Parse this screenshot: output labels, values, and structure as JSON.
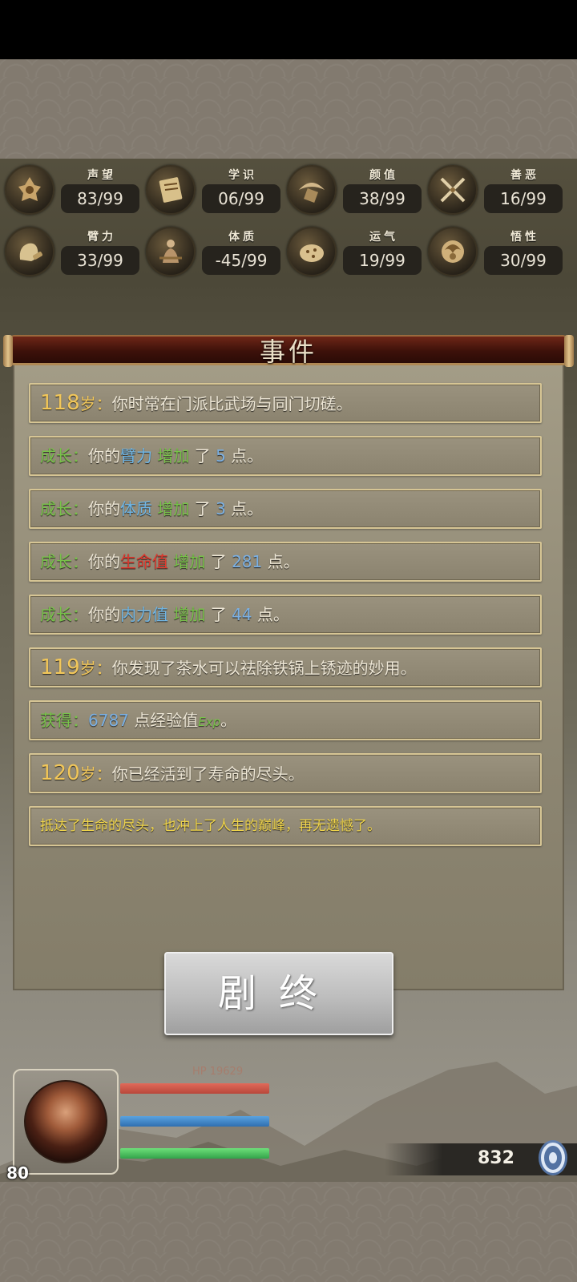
{
  "attributes": [
    {
      "label": "声望",
      "value": "83/99",
      "icon": "fame-icon"
    },
    {
      "label": "学识",
      "value": "06/99",
      "icon": "knowledge-icon"
    },
    {
      "label": "颜值",
      "value": "38/99",
      "icon": "appearance-icon"
    },
    {
      "label": "善恶",
      "value": "16/99",
      "icon": "morality-icon"
    },
    {
      "label": "臂力",
      "value": "33/99",
      "icon": "strength-icon"
    },
    {
      "label": "体质",
      "value": "-45/99",
      "icon": "constitution-icon"
    },
    {
      "label": "运气",
      "value": "19/99",
      "icon": "luck-icon"
    },
    {
      "label": "悟性",
      "value": "30/99",
      "icon": "comprehension-icon"
    }
  ],
  "events_panel": {
    "title": "事件",
    "events": [
      {
        "age": "118",
        "age_unit": "岁：",
        "text": "你时常在门派比武场与同门切磋。"
      },
      {
        "prefix": "成长：",
        "pre": "你的",
        "attr": "臂力",
        "attr_color": "#6fb6e6",
        "verb": " 增加 ",
        "mid": "了 ",
        "num": "5",
        "end": " 点。"
      },
      {
        "prefix": "成长：",
        "pre": "你的",
        "attr": "体质",
        "attr_color": "#6fb6e6",
        "verb": " 增加 ",
        "mid": "了 ",
        "num": "3",
        "end": " 点。"
      },
      {
        "prefix": "成长：",
        "pre": "你的",
        "attr": "生命值",
        "attr_color": "#e2392f",
        "verb": " 增加 ",
        "mid": "了 ",
        "num": "281",
        "end": " 点。"
      },
      {
        "prefix": "成长：",
        "pre": "你的",
        "attr": "内力值",
        "attr_color": "#6fb6e6",
        "verb": " 增加 ",
        "mid": "了 ",
        "num": "44",
        "end": " 点。"
      },
      {
        "age": "119",
        "age_unit": "岁：",
        "text": "你发现了茶水可以祛除铁锅上锈迹的妙用。"
      },
      {
        "prefix": "获得：",
        "num": "6787",
        "text": " 点经验值",
        "exp": "Exp",
        "end": "。"
      },
      {
        "age": "120",
        "age_unit": "岁：",
        "text": "你已经活到了寿命的尽头。"
      },
      {
        "text": "抵达了生命的尽头，也冲上了人生的巅峰，再无遗憾了。"
      }
    ]
  },
  "end_button": {
    "label": "剧终"
  },
  "hero": {
    "level": "80",
    "hp_label": "HP 19629",
    "hp_fill": 1.0,
    "mp_fill": 1.0,
    "sp_fill": 1.0
  },
  "currency": {
    "value": "832",
    "icon": "coin-icon"
  },
  "colors": {
    "age": "#f2c75a",
    "growth": "#78c24a",
    "number": "#7bb0e3",
    "finale": "#f0d54a"
  }
}
